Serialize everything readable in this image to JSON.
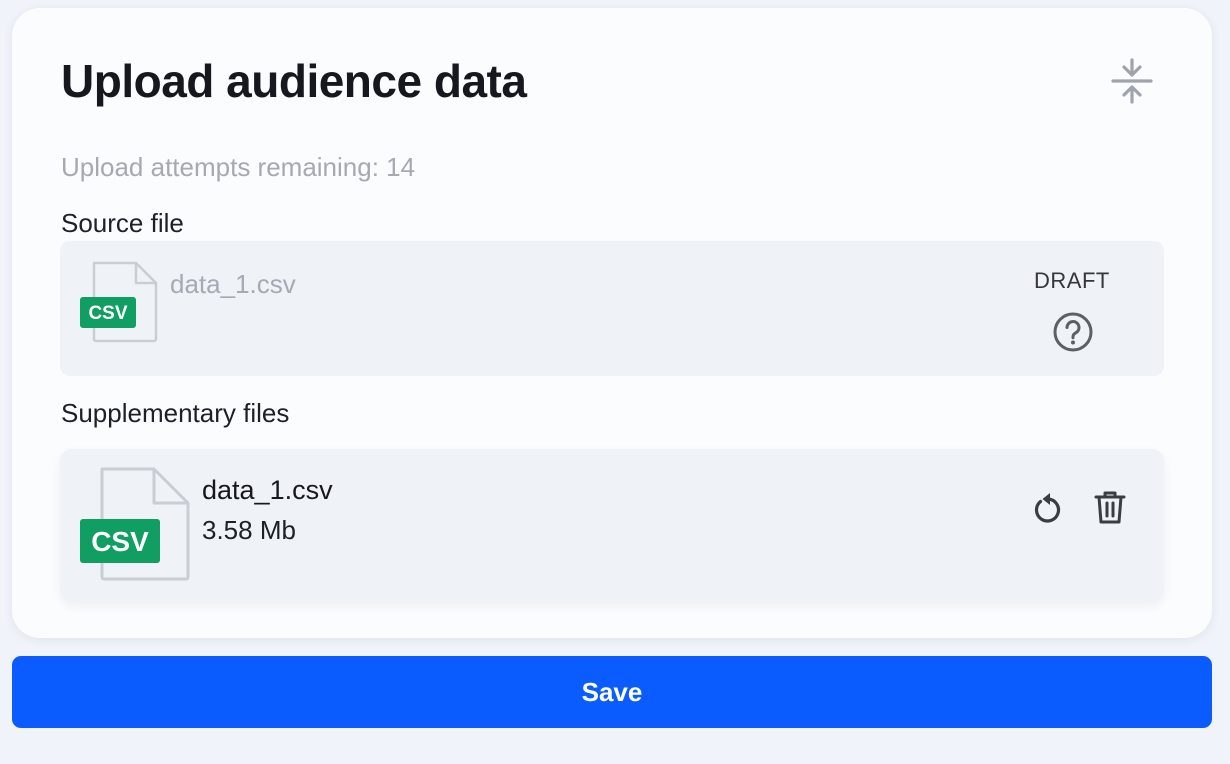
{
  "header": {
    "title": "Upload audience data",
    "collapse_icon": "collapse-vertical-icon"
  },
  "upload": {
    "attempts_text": "Upload attempts remaining: 14"
  },
  "source": {
    "label": "Source file",
    "file": {
      "name": "data_1.csv",
      "badge": "CSV",
      "status": "DRAFT",
      "status_icon": "help-circle-icon"
    }
  },
  "supplementary": {
    "label": "Supplementary files",
    "files": [
      {
        "name": "data_1.csv",
        "size": "3.58 Mb",
        "badge": "CSV",
        "actions": [
          "refresh-icon",
          "trash-icon"
        ]
      }
    ]
  },
  "footer": {
    "save_label": "Save"
  },
  "colors": {
    "accent": "#0a5cff",
    "csv_badge": "#109e63"
  }
}
